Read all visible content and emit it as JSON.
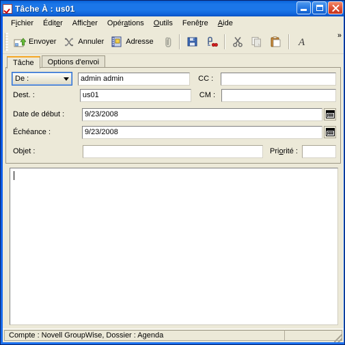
{
  "window": {
    "title": "Tâche À : us01",
    "icon": "task-checkbox-icon",
    "buttons": {
      "minimize": "minimize-button",
      "maximize": "maximize-button",
      "close": "close-button"
    }
  },
  "menubar": {
    "items": [
      {
        "label": "Fichier",
        "pre": "F",
        "acc": "i",
        "post": "chier"
      },
      {
        "label": "Éditer",
        "pre": "Édit",
        "acc": "e",
        "post": "r"
      },
      {
        "label": "Afficher",
        "pre": "Affic",
        "acc": "h",
        "post": "er"
      },
      {
        "label": "Opérations",
        "pre": "Opér",
        "acc": "a",
        "post": "tions"
      },
      {
        "label": "Outils",
        "pre": "",
        "acc": "O",
        "post": "utils"
      },
      {
        "label": "Fenêtre",
        "pre": "Fenê",
        "acc": "t",
        "post": "re"
      },
      {
        "label": "Aide",
        "pre": "",
        "acc": "A",
        "post": "ide"
      }
    ]
  },
  "toolbar": {
    "send_label": "Envoyer",
    "cancel_label": "Annuler",
    "address_label": "Adresse",
    "attach_icon": "paperclip-icon",
    "save_icon": "save-floppy-icon",
    "spellcheck_icon": "spellcheck-icon",
    "cut_icon": "scissors-cut-icon",
    "copy_icon": "copy-icon",
    "paste_icon": "paste-clipboard-icon",
    "font_icon": "font-icon",
    "overflow_label": "»"
  },
  "tabs": [
    {
      "label": "Tâche",
      "active": true
    },
    {
      "label": "Options d'envoi",
      "active": false
    }
  ],
  "form": {
    "from": {
      "selected": "De :",
      "options": [
        "De :"
      ],
      "value": "admin admin"
    },
    "to": {
      "label": "Dest. :",
      "value": "us01"
    },
    "cc": {
      "label": "CC :",
      "value": ""
    },
    "bcc": {
      "label": "CM :",
      "value": ""
    },
    "start_date": {
      "label": "Date de début :",
      "value": "9/23/2008"
    },
    "due_date": {
      "label": "Échéance :",
      "value": "9/23/2008"
    },
    "subject": {
      "label": "Objet :",
      "value": ""
    },
    "priority": {
      "label": "Priorité :",
      "value": ""
    },
    "calendar_icon": "calendar-picker-icon"
  },
  "body": {
    "value": "",
    "placeholder": ""
  },
  "statusbar": {
    "text": "Compte : Novell GroupWise,  Dossier : Agenda",
    "right_panel": ""
  },
  "colors": {
    "title_bar_blue": "#1b76e8",
    "window_border": "#0a246a",
    "face": "#ece9d8",
    "field_bg": "#ffffff",
    "tab_accent": "#f5a623",
    "close_red": "#c5331c"
  }
}
